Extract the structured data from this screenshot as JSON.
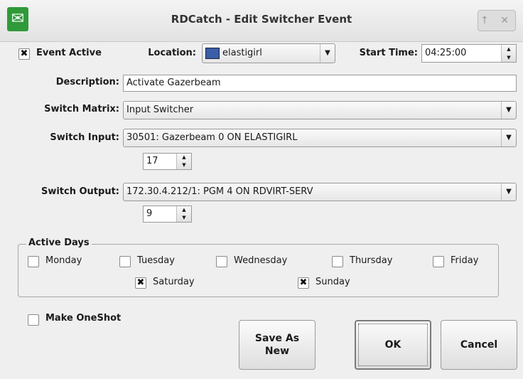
{
  "window": {
    "title": "RDCatch - Edit Switcher Event",
    "controls": "↑ ✕"
  },
  "event_active": {
    "label": "Event Active",
    "checked": true
  },
  "location": {
    "label": "Location:",
    "value": "elastigirl"
  },
  "start_time": {
    "label": "Start Time:",
    "value": "04:25:00"
  },
  "description": {
    "label": "Description:",
    "value": "Activate Gazerbeam"
  },
  "switch_matrix": {
    "label": "Switch Matrix:",
    "value": "Input Switcher"
  },
  "switch_input": {
    "label": "Switch Input:",
    "value": "30501: Gazerbeam 0 ON ELASTIGIRL",
    "number": "17"
  },
  "switch_output": {
    "label": "Switch Output:",
    "value": "172.30.4.212/1: PGM 4 ON RDVIRT-SERV",
    "number": "9"
  },
  "active_days": {
    "title": "Active Days",
    "monday": {
      "label": "Monday",
      "checked": false
    },
    "tuesday": {
      "label": "Tuesday",
      "checked": false
    },
    "wednesday": {
      "label": "Wednesday",
      "checked": false
    },
    "thursday": {
      "label": "Thursday",
      "checked": false
    },
    "friday": {
      "label": "Friday",
      "checked": false
    },
    "saturday": {
      "label": "Saturday",
      "checked": true
    },
    "sunday": {
      "label": "Sunday",
      "checked": true
    }
  },
  "make_oneshot": {
    "label": "Make OneShot",
    "checked": false
  },
  "buttons": {
    "save_line1": "Save As",
    "save_line2": "New",
    "ok": "OK",
    "cancel": "Cancel"
  },
  "check_mark": "✖"
}
